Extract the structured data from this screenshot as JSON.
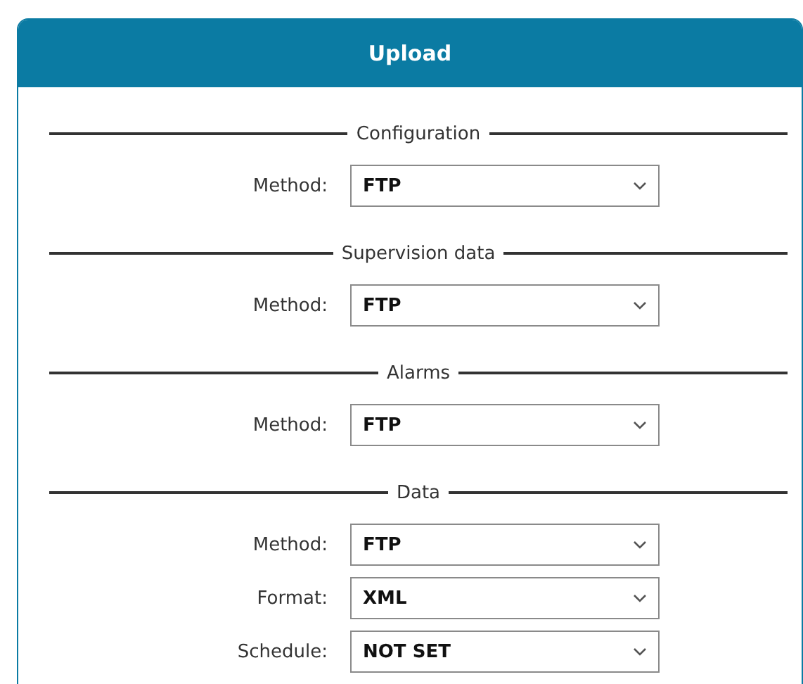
{
  "panel": {
    "title": "Upload"
  },
  "sections": [
    {
      "title": "Configuration",
      "fields": [
        {
          "label": "Method:",
          "value": "FTP"
        }
      ]
    },
    {
      "title": "Supervision data",
      "fields": [
        {
          "label": "Method:",
          "value": "FTP"
        }
      ]
    },
    {
      "title": "Alarms",
      "fields": [
        {
          "label": "Method:",
          "value": "FTP"
        }
      ]
    },
    {
      "title": "Data",
      "fields": [
        {
          "label": "Method:",
          "value": "FTP"
        },
        {
          "label": "Format:",
          "value": "XML"
        },
        {
          "label": "Schedule:",
          "value": "NOT SET"
        }
      ]
    }
  ]
}
